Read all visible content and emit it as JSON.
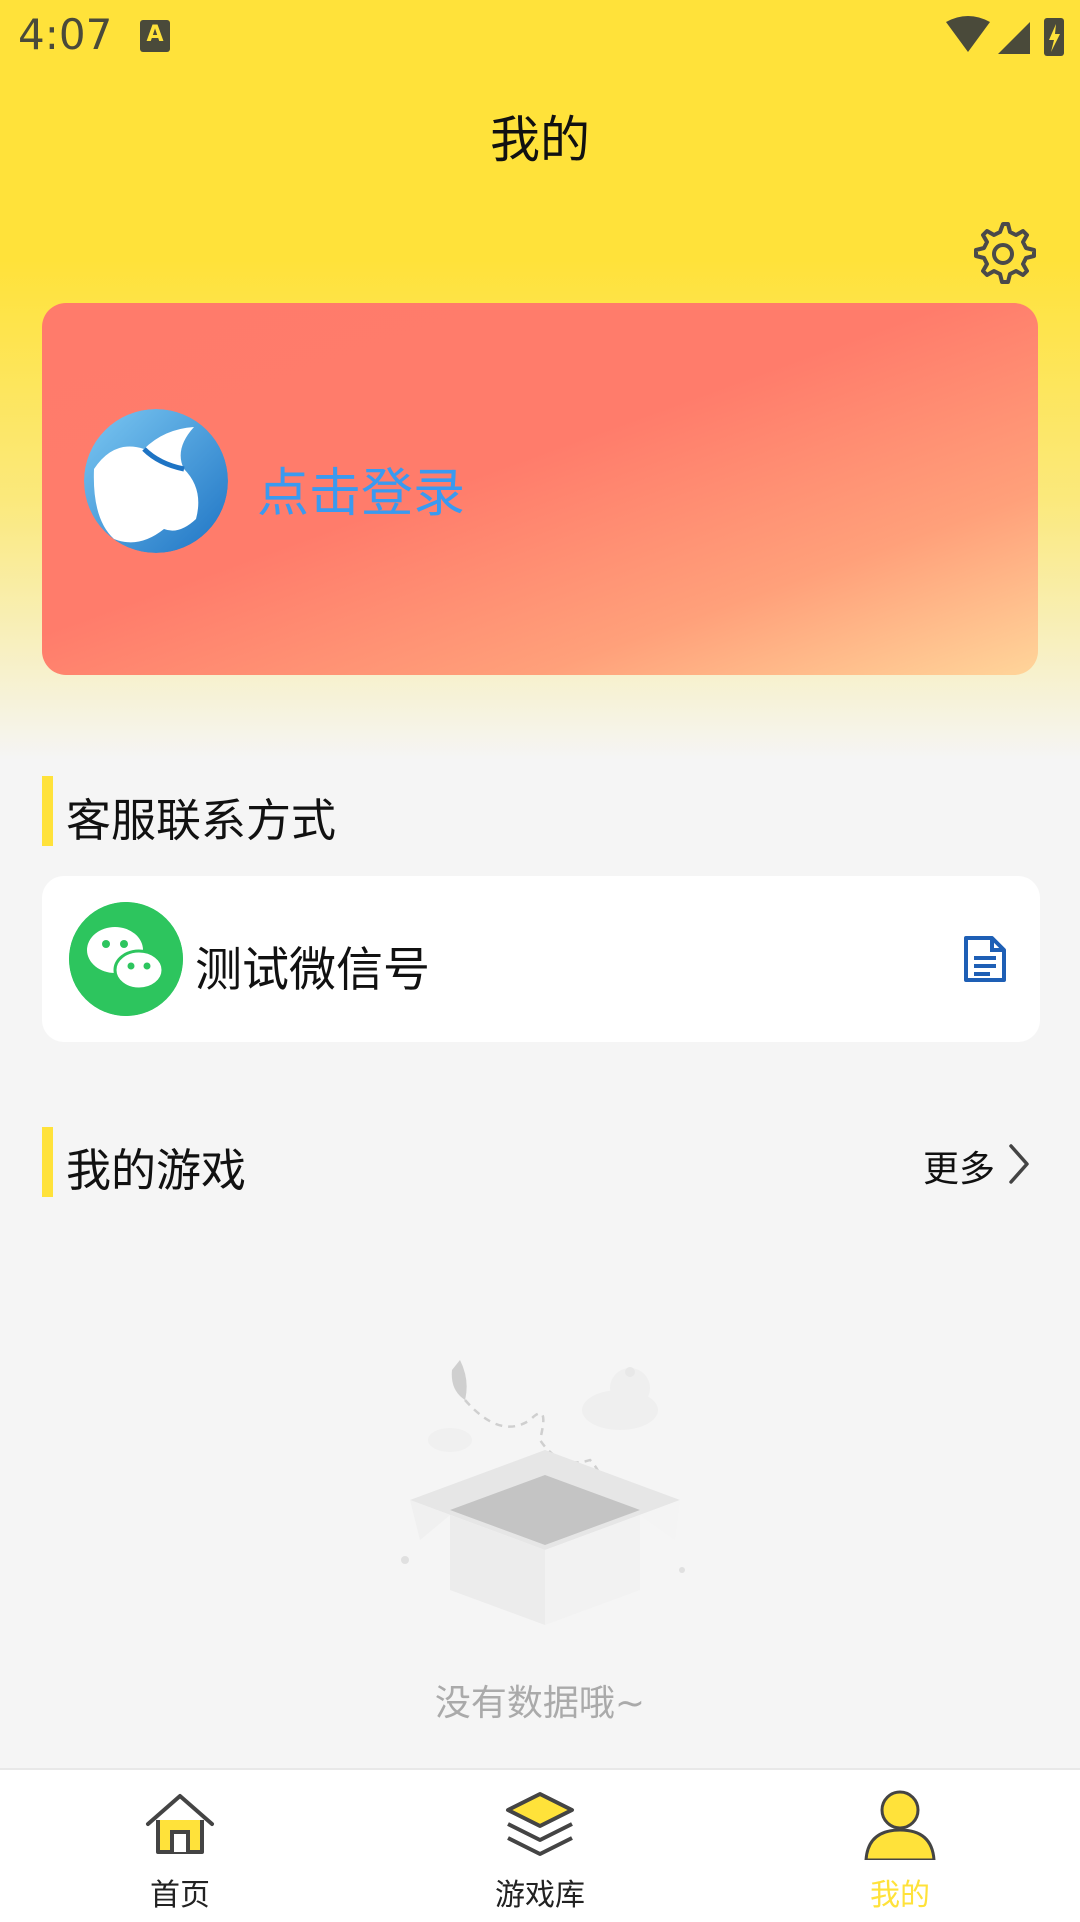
{
  "status_bar": {
    "time": "4:07",
    "notification_letter": "A"
  },
  "header": {
    "title": "我的"
  },
  "login_card": {
    "label": "点击登录",
    "label_color": "#3a9af0"
  },
  "customer_service": {
    "section_title": "客服联系方式",
    "item_label": "测试微信号"
  },
  "my_games": {
    "section_title": "我的游戏",
    "more_label": "更多",
    "empty_text": "没有数据哦~"
  },
  "bottom_nav": {
    "items": [
      {
        "label": "首页",
        "icon": "home-icon",
        "active": false
      },
      {
        "label": "游戏库",
        "icon": "layers-icon",
        "active": false
      },
      {
        "label": "我的",
        "icon": "user-icon",
        "active": true
      }
    ],
    "active_color": "#ffe23a"
  },
  "colors": {
    "accent": "#ffe23a",
    "wechat_green": "#2dc55e",
    "copy_icon_blue": "#1e5fb5"
  }
}
